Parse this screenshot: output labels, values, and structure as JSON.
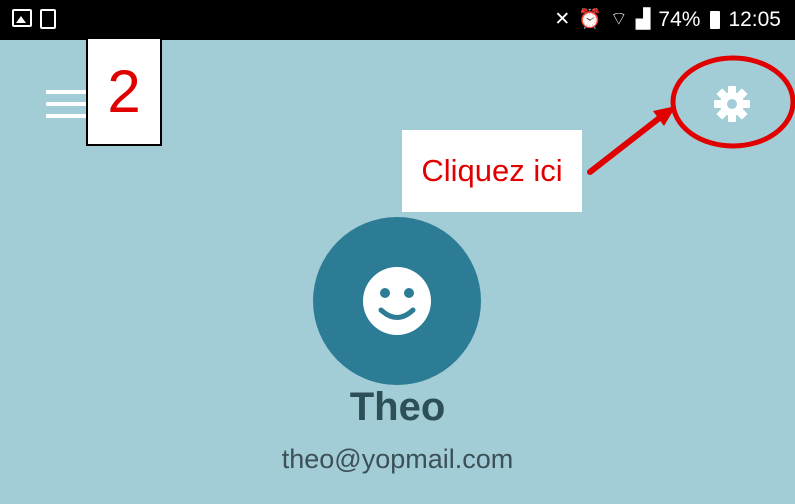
{
  "status_bar": {
    "battery": "74%",
    "time": "12:05",
    "icons": [
      "gallery-icon",
      "clipboard-icon",
      "mute-icon",
      "alarm-icon",
      "wifi-icon",
      "signal-icon",
      "battery-icon"
    ]
  },
  "header": {
    "menu_icon": "hamburger-menu-icon",
    "settings_icon": "gear-icon"
  },
  "profile": {
    "avatar_icon": "smiley-face-icon",
    "name": "Theo",
    "email": "theo@yopmail.com"
  },
  "annotations": {
    "step_number": "2",
    "callout_text": "Cliquez ici",
    "highlight_color": "#e00000"
  },
  "colors": {
    "app_background": "#a3cdd6",
    "avatar_background": "#2d7c95",
    "status_bar": "#000000"
  }
}
